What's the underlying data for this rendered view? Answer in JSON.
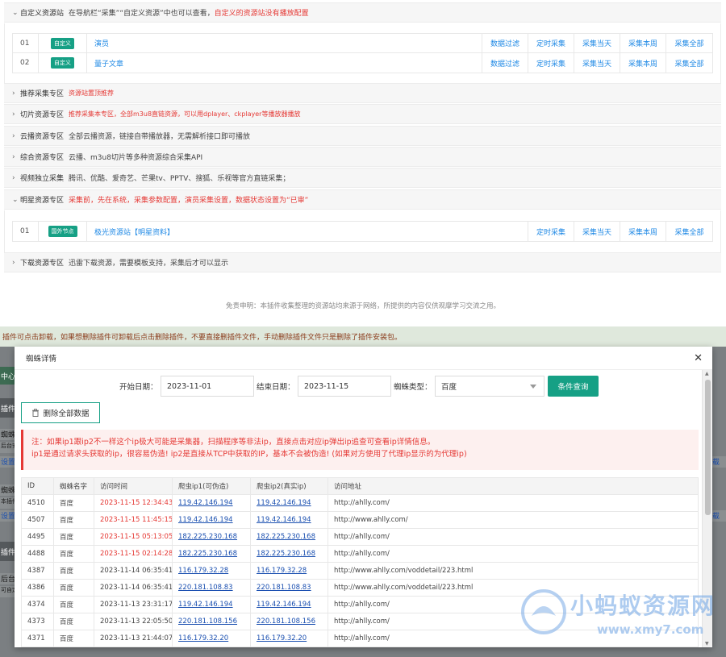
{
  "top": {
    "custom_section": {
      "title": "自定义资源站",
      "desc": "在导航栏“采集”“自定义资源”中也可以查看，",
      "desc_red": "自定义的资源站没有播放配置",
      "rows": [
        {
          "num": "01",
          "tag": "自定义",
          "name": "演员",
          "actions": [
            "数据过滤",
            "定时采集",
            "采集当天",
            "采集本周",
            "采集全部"
          ]
        },
        {
          "num": "02",
          "tag": "自定义",
          "name": "量子文章",
          "actions": [
            "数据过滤",
            "定时采集",
            "采集当天",
            "采集本周",
            "采集全部"
          ]
        }
      ]
    },
    "sections": [
      {
        "title": "推荐采集专区",
        "desc": "资源站置顶推荐"
      },
      {
        "title": "切片资源专区",
        "desc": "推荐采集本专区，全部m3u8直链资源，可以用dplayer、ckplayer等播放器播放"
      },
      {
        "title": "云播资源专区",
        "desc": "全部云播资源，链接自带播放器，无需解析接口即可播放"
      },
      {
        "title": "综合资源专区",
        "desc": "云播、m3u8切片等多种资源综合采集API"
      },
      {
        "title": "视频独立采集",
        "desc": "腾讯、优酷、爱奇艺、芒果tv、PPTV、搜狐、乐视等官方直链采集；"
      }
    ],
    "star_section": {
      "title": "明星资源专区",
      "desc": "采集前，先在系统，采集参数配置，演员采集设置，数据状态设置为“已审”",
      "rows": [
        {
          "num": "01",
          "tag": "国外节点",
          "name": "极光资源站【明星资料】",
          "actions": [
            "定时采集",
            "采集当天",
            "采集本周",
            "采集全部"
          ]
        }
      ]
    },
    "download_section": {
      "title": "下载资源专区",
      "desc": "迅雷下载资源，需要模板支持，采集后才可以显示"
    },
    "disclaimer": "免责申明：本插件收集整理的资源站均来源于网络，所提供的内容仅供观摩学习交流之用。"
  },
  "background": {
    "notice": "插件可点击卸载，如果想删除插件可卸载后点击删除插件，不要直接删插件文件，手动删除插件文件只是删除了插件安装包。",
    "left_fragments": [
      "中心",
      "插件",
      "蜘蛛",
      "后台安装",
      "设置",
      "蜘蛛统",
      "本插件",
      "设置",
      "插件",
      "后台登",
      "可自定"
    ],
    "right_fragments": [
      "载",
      "载"
    ]
  },
  "modal": {
    "title": "蜘蛛详情",
    "start_label": "开始日期：",
    "start_value": "2023-11-01",
    "end_label": "结束日期：",
    "end_value": "2023-11-15",
    "type_label": "蜘蛛类型：",
    "type_value": "百度",
    "query_label": "条件查询",
    "delete_label": "删除全部数据",
    "warn_line1": "注：如果ip1跟ip2不一样这个ip极大可能是采集器，扫描程序等非法ip，直接点击对应ip弹出ip追查可查看ip详情信息。",
    "warn_line2": "ip1是通过请求头获取的ip，很容易伪造! ip2是直接从TCP中获取的IP，基本不会被伪造! (如果对方使用了代理ip显示的为代理ip)",
    "columns": [
      "ID",
      "蜘蛛名字",
      "访问时间",
      "爬虫ip1(可伪造)",
      "爬虫ip2(真实ip)",
      "访问地址"
    ],
    "rows": [
      {
        "id": "4510",
        "name": "百度",
        "time": "2023-11-15 12:34:43",
        "ip1": "119.42.146.194",
        "ip2": "119.42.146.194",
        "url": "http://ahlly.com/",
        "highlight": true
      },
      {
        "id": "4507",
        "name": "百度",
        "time": "2023-11-15 11:45:15",
        "ip1": "119.42.146.194",
        "ip2": "119.42.146.194",
        "url": "http://www.ahlly.com/",
        "highlight": true
      },
      {
        "id": "4495",
        "name": "百度",
        "time": "2023-11-15 05:13:05",
        "ip1": "182.225.230.168",
        "ip2": "182.225.230.168",
        "url": "http://ahlly.com/",
        "highlight": true
      },
      {
        "id": "4488",
        "name": "百度",
        "time": "2023-11-15 02:14:28",
        "ip1": "182.225.230.168",
        "ip2": "182.225.230.168",
        "url": "http://ahlly.com/",
        "highlight": true
      },
      {
        "id": "4387",
        "name": "百度",
        "time": "2023-11-14 06:35:41",
        "ip1": "116.179.32.28",
        "ip2": "116.179.32.28",
        "url": "http://www.ahlly.com/voddetail/223.html",
        "highlight": false
      },
      {
        "id": "4386",
        "name": "百度",
        "time": "2023-11-14 06:35:41",
        "ip1": "220.181.108.83",
        "ip2": "220.181.108.83",
        "url": "http://www.ahlly.com/voddetail/223.html",
        "highlight": false
      },
      {
        "id": "4374",
        "name": "百度",
        "time": "2023-11-13 23:31:17",
        "ip1": "119.42.146.194",
        "ip2": "119.42.146.194",
        "url": "http://ahlly.com/",
        "highlight": false
      },
      {
        "id": "4373",
        "name": "百度",
        "time": "2023-11-13 22:05:50",
        "ip1": "220.181.108.156",
        "ip2": "220.181.108.156",
        "url": "http://ahlly.com/",
        "highlight": false
      },
      {
        "id": "4371",
        "name": "百度",
        "time": "2023-11-13 21:44:07",
        "ip1": "116.179.32.20",
        "ip2": "116.179.32.20",
        "url": "http://ahlly.com/",
        "highlight": false
      }
    ]
  },
  "watermark": {
    "title": "小蚂蚁资源网",
    "url": "www.xmy7.com"
  },
  "colors": {
    "accent": "#16a085",
    "link": "#1e88e5",
    "danger": "#e53935"
  }
}
